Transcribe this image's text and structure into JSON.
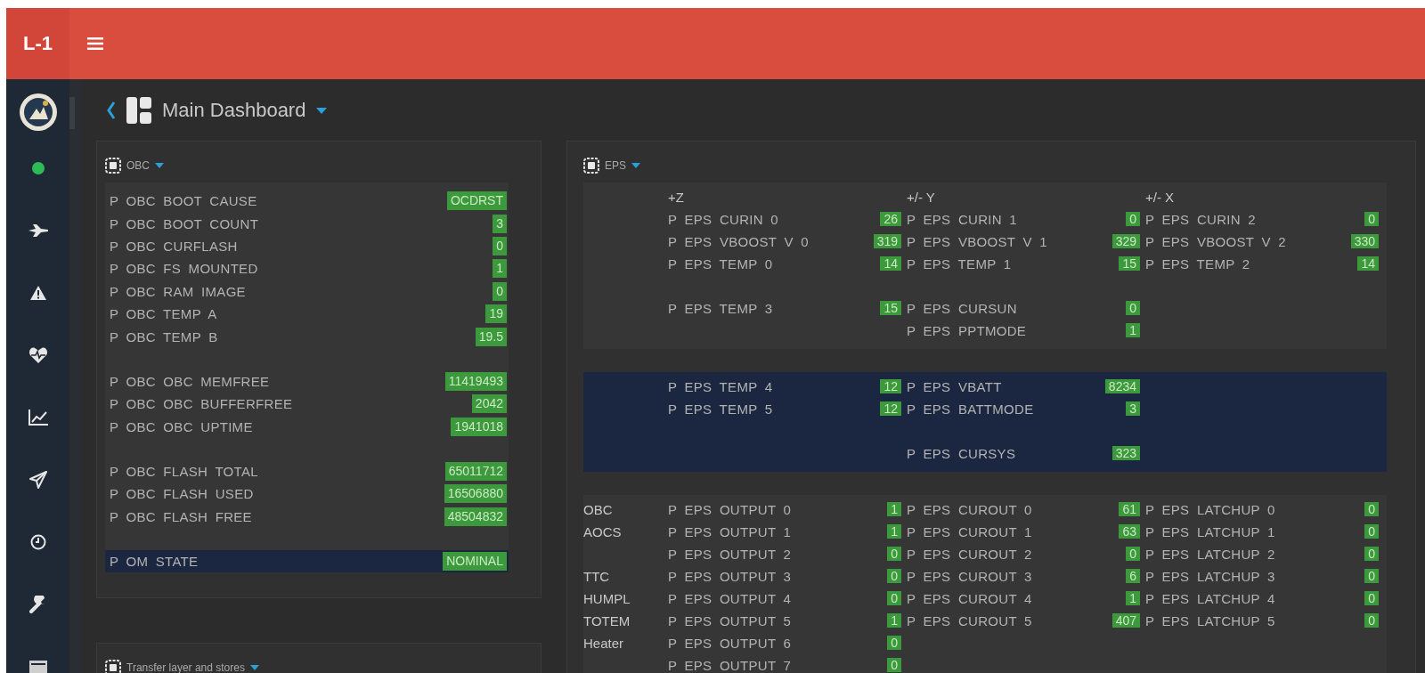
{
  "header": {
    "brand": "L-1"
  },
  "breadcrumb": {
    "title": "Main Dashboard"
  },
  "obc_panel": {
    "title": "OBC",
    "groups": [
      {
        "highlighted": false,
        "rows": [
          {
            "label": "P OBC BOOT CAUSE",
            "value": "OCDRST"
          },
          {
            "label": "P OBC BOOT COUNT",
            "value": "3"
          },
          {
            "label": "P OBC CURFLASH",
            "value": "0"
          },
          {
            "label": "P OBC FS MOUNTED",
            "value": "1"
          },
          {
            "label": "P OBC RAM IMAGE",
            "value": "0"
          },
          {
            "label": "P OBC TEMP A",
            "value": "19"
          },
          {
            "label": "P OBC TEMP B",
            "value": "19.5"
          }
        ]
      },
      {
        "highlighted": false,
        "rows": [
          {
            "label": "P OBC OBC MEMFREE",
            "value": "11419493"
          },
          {
            "label": "P OBC OBC BUFFERFREE",
            "value": "2042"
          },
          {
            "label": "P OBC OBC UPTIME",
            "value": "1941018"
          }
        ]
      },
      {
        "highlighted": false,
        "rows": [
          {
            "label": "P OBC FLASH TOTAL",
            "value": "65011712"
          },
          {
            "label": "P OBC FLASH USED",
            "value": "16506880"
          },
          {
            "label": "P OBC FLASH FREE",
            "value": "48504832"
          }
        ]
      },
      {
        "highlighted": true,
        "rows": [
          {
            "label": "P OM STATE",
            "value": "NOMINAL"
          }
        ]
      }
    ]
  },
  "eps_panel": {
    "title": "EPS",
    "sections": [
      {
        "highlighted": false,
        "rows": [
          {
            "kind": "header",
            "cells": [
              "+Z",
              "+/- Y",
              "+/- X"
            ]
          },
          {
            "kind": "data",
            "cells": [
              {
                "label": "P EPS CURIN 0",
                "value": "26"
              },
              {
                "label": "P EPS CURIN 1",
                "value": "0"
              },
              {
                "label": "P EPS CURIN 2",
                "value": "0"
              }
            ]
          },
          {
            "kind": "data",
            "cells": [
              {
                "label": "P EPS VBOOST V 0",
                "value": "319"
              },
              {
                "label": "P EPS VBOOST V 1",
                "value": "329"
              },
              {
                "label": "P EPS VBOOST V 2",
                "value": "330"
              }
            ]
          },
          {
            "kind": "data",
            "cells": [
              {
                "label": "P EPS TEMP 0",
                "value": "14"
              },
              {
                "label": "P EPS TEMP 1",
                "value": "15"
              },
              {
                "label": "P EPS TEMP 2",
                "value": "14"
              }
            ]
          },
          {
            "kind": "spacer"
          },
          {
            "kind": "data",
            "cells": [
              {
                "label": "P EPS TEMP 3",
                "value": "15"
              },
              {
                "label": "P EPS CURSUN",
                "value": "0"
              },
              null
            ]
          },
          {
            "kind": "data",
            "cells": [
              null,
              {
                "label": "P EPS PPTMODE",
                "value": "1"
              },
              null
            ]
          }
        ]
      },
      {
        "highlighted": true,
        "rows": [
          {
            "kind": "data",
            "cells": [
              {
                "label": "P EPS TEMP 4",
                "value": "12"
              },
              {
                "label": "P EPS VBATT",
                "value": "8234"
              },
              null
            ]
          },
          {
            "kind": "data",
            "cells": [
              {
                "label": "P EPS TEMP 5",
                "value": "12"
              },
              {
                "label": "P EPS BATTMODE",
                "value": "3"
              },
              null
            ]
          },
          {
            "kind": "spacer"
          },
          {
            "kind": "data",
            "cells": [
              null,
              {
                "label": "P EPS CURSYS",
                "value": "323"
              },
              null
            ]
          }
        ]
      },
      {
        "highlighted": false,
        "rows": [
          {
            "kind": "data",
            "tag": "OBC",
            "cells": [
              {
                "label": "P EPS OUTPUT 0",
                "value": "1"
              },
              {
                "label": "P EPS CUROUT 0",
                "value": "61"
              },
              {
                "label": "P EPS LATCHUP 0",
                "value": "0"
              }
            ]
          },
          {
            "kind": "data",
            "tag": "AOCS",
            "cells": [
              {
                "label": "P EPS OUTPUT 1",
                "value": "1"
              },
              {
                "label": "P EPS CUROUT 1",
                "value": "63"
              },
              {
                "label": "P EPS LATCHUP 1",
                "value": "0"
              }
            ]
          },
          {
            "kind": "data",
            "cells": [
              {
                "label": "P EPS OUTPUT 2",
                "value": "0"
              },
              {
                "label": "P EPS CUROUT 2",
                "value": "0"
              },
              {
                "label": "P EPS LATCHUP 2",
                "value": "0"
              }
            ]
          },
          {
            "kind": "data",
            "tag": "TTC",
            "cells": [
              {
                "label": "P EPS OUTPUT 3",
                "value": "0"
              },
              {
                "label": "P EPS CUROUT 3",
                "value": "6"
              },
              {
                "label": "P EPS LATCHUP 3",
                "value": "0"
              }
            ]
          },
          {
            "kind": "data",
            "tag": "HUMPL",
            "cells": [
              {
                "label": "P EPS OUTPUT 4",
                "value": "0"
              },
              {
                "label": "P EPS CUROUT 4",
                "value": "1"
              },
              {
                "label": "P EPS LATCHUP 4",
                "value": "0"
              }
            ]
          },
          {
            "kind": "data",
            "tag": "TOTEM",
            "cells": [
              {
                "label": "P EPS OUTPUT 5",
                "value": "1"
              },
              {
                "label": "P EPS CUROUT 5",
                "value": "407"
              },
              {
                "label": "P EPS LATCHUP 5",
                "value": "0"
              }
            ]
          },
          {
            "kind": "data",
            "tag": "Heater",
            "cells": [
              {
                "label": "P EPS OUTPUT 6",
                "value": "0"
              },
              null,
              null
            ]
          },
          {
            "kind": "data",
            "cells": [
              {
                "label": "P EPS OUTPUT 7",
                "value": "0"
              },
              null,
              null
            ]
          }
        ]
      }
    ]
  },
  "transfer_panel": {
    "title": "Transfer layer and stores"
  }
}
